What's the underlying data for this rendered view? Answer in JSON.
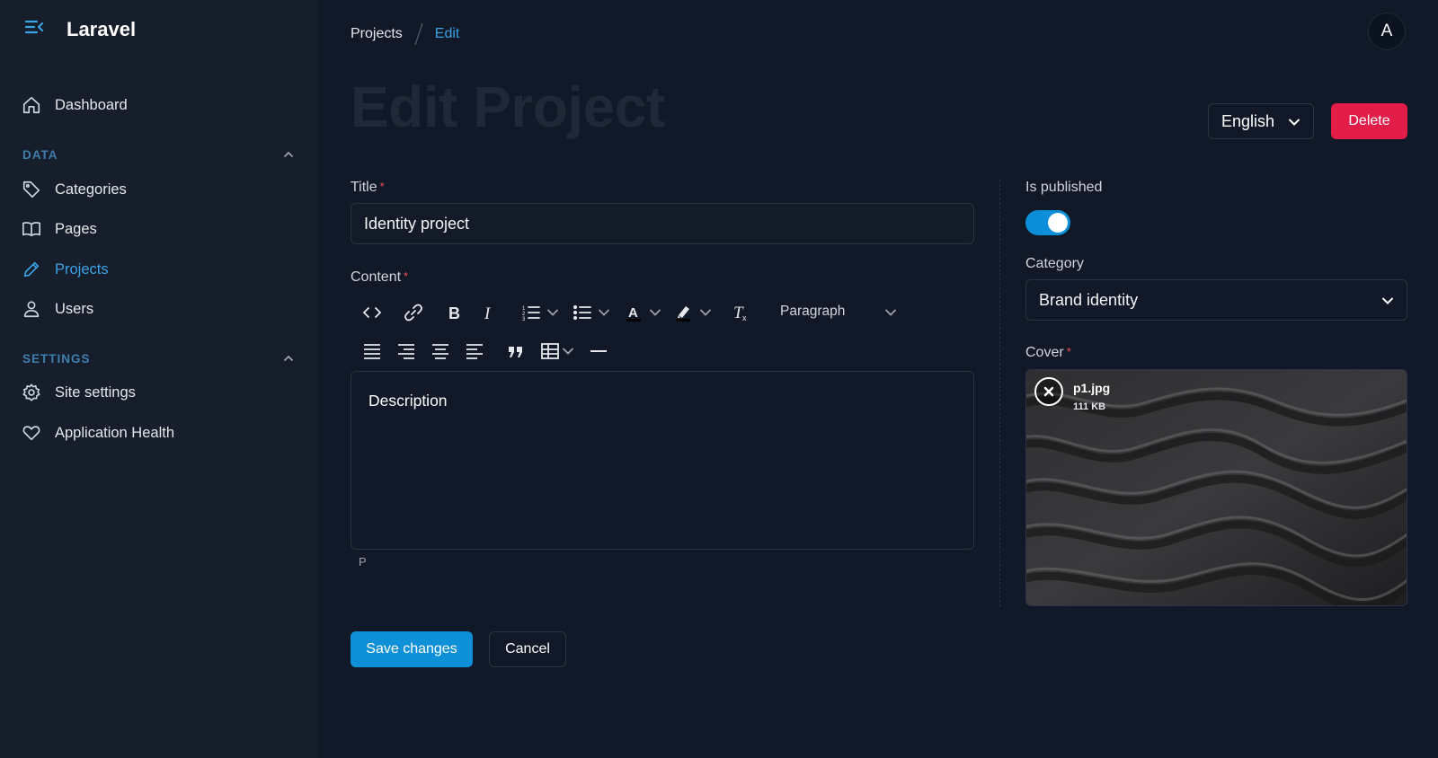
{
  "app": {
    "name": "Laravel"
  },
  "sidebar": {
    "items": [
      {
        "label": "Dashboard",
        "icon": "home-icon"
      },
      {
        "label": "Categories",
        "icon": "tag-icon"
      },
      {
        "label": "Pages",
        "icon": "book-icon"
      },
      {
        "label": "Projects",
        "icon": "pencil-icon",
        "active": true
      },
      {
        "label": "Users",
        "icon": "user-icon"
      },
      {
        "label": "Site settings",
        "icon": "gear-icon"
      },
      {
        "label": "Application Health",
        "icon": "heart-icon"
      }
    ],
    "groups": {
      "data": "DATA",
      "settings": "SETTINGS"
    }
  },
  "breadcrumb": {
    "parent": "Projects",
    "current": "Edit"
  },
  "user": {
    "avatar_initial": "A"
  },
  "page": {
    "title": "Edit Project"
  },
  "header": {
    "language": "English",
    "delete_label": "Delete"
  },
  "form": {
    "title_label": "Title",
    "title_value": "Identity project",
    "content_label": "Content",
    "required_mark": "*",
    "paragraph_format": "Paragraph",
    "editor_text": "Description",
    "editor_path": "P",
    "published_label": "Is published",
    "published": true,
    "category_label": "Category",
    "category_value": "Brand identity",
    "cover_label": "Cover",
    "file_name": "p1.jpg",
    "file_size": "111 KB"
  },
  "actions": {
    "save_label": "Save changes",
    "cancel_label": "Cancel"
  },
  "colors": {
    "accent": "#0e90d8",
    "danger": "#e11d48",
    "background": "#111827",
    "sidebar": "#161d2b"
  }
}
